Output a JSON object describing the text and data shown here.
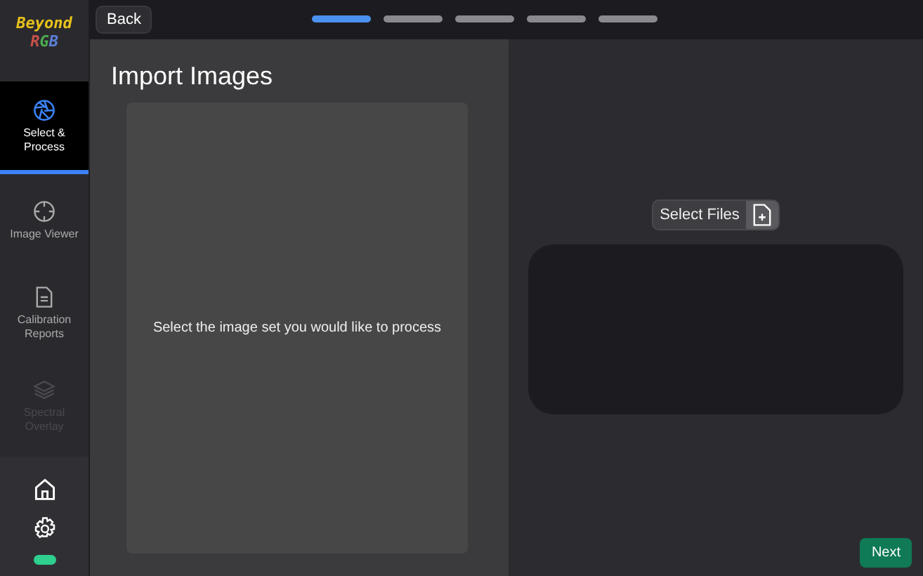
{
  "logo": {
    "line1": "Beyond",
    "line2_letters": [
      "R",
      "G",
      "B"
    ]
  },
  "top_bar": {
    "back_button": "Back",
    "steps": [
      {
        "selected": true
      },
      {
        "selected": false
      },
      {
        "selected": false
      },
      {
        "selected": false
      },
      {
        "selected": false
      }
    ]
  },
  "sidebar": {
    "items": [
      {
        "kind": "aperture",
        "label": "Select & Process",
        "selected": true,
        "disabled": false
      },
      {
        "kind": "crosshair",
        "label": "Image Viewer",
        "selected": false,
        "disabled": false
      },
      {
        "kind": "document",
        "label": "Calibration Reports",
        "selected": false,
        "disabled": false
      },
      {
        "kind": "layers",
        "label": "Spectral Overlay",
        "selected": false,
        "disabled": true
      }
    ]
  },
  "main": {
    "title": "Import Images",
    "placeholder_text": "Select the image set you would like to process",
    "select_files_button": "Select Files",
    "next_button": "Next"
  }
}
